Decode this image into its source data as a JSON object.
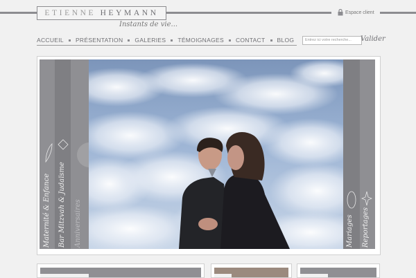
{
  "brand": {
    "name_part1": "ETIENNE",
    "name_part2": "HEYMANN",
    "tagline": "Instants de vie..."
  },
  "header": {
    "client_space": "Espace client"
  },
  "nav": {
    "items": [
      "ACCUEIL",
      "PRÉSENTATION",
      "GALERIES",
      "TÉMOIGNAGES",
      "CONTACT",
      "BLOG"
    ]
  },
  "search": {
    "placeholder": "Entrez ici votre recherche...",
    "button": "Valider"
  },
  "slider": {
    "left_labels": [
      "Maternité & Enfance",
      "Bar Mitzvah & Judaïsme",
      "Anniversaires"
    ],
    "right_labels": [
      "Mariages",
      "Reportages"
    ]
  },
  "colors": {
    "accent_gray": "#8c8c90",
    "panel_gray": "#8f8f93",
    "background": "#f1f1f1"
  }
}
